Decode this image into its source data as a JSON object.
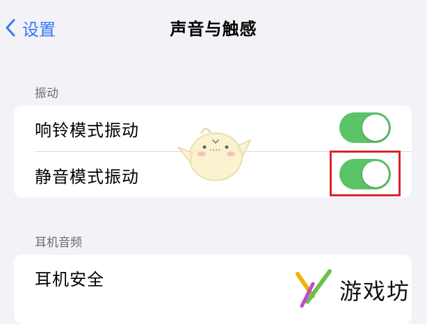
{
  "nav": {
    "back_label": "设置",
    "title": "声音与触感"
  },
  "sections": [
    {
      "header": "振动",
      "rows": [
        {
          "label": "响铃模式振动",
          "toggle_on": true
        },
        {
          "label": "静音模式振动",
          "toggle_on": true,
          "highlighted": true
        }
      ]
    },
    {
      "header": "耳机音频",
      "rows": [
        {
          "label": "耳机安全"
        }
      ]
    }
  ],
  "watermark": {
    "text": "游戏坊"
  },
  "colors": {
    "accent_blue": "#3478f6",
    "toggle_on_green": "#5ac466",
    "highlight_red": "#d9252a",
    "background": "#f2f2f7"
  },
  "icons": {
    "back": "chevron-left-icon",
    "mascot": "mascot-sticker-icon",
    "watermark_logo": "watermark-logo-icon"
  }
}
